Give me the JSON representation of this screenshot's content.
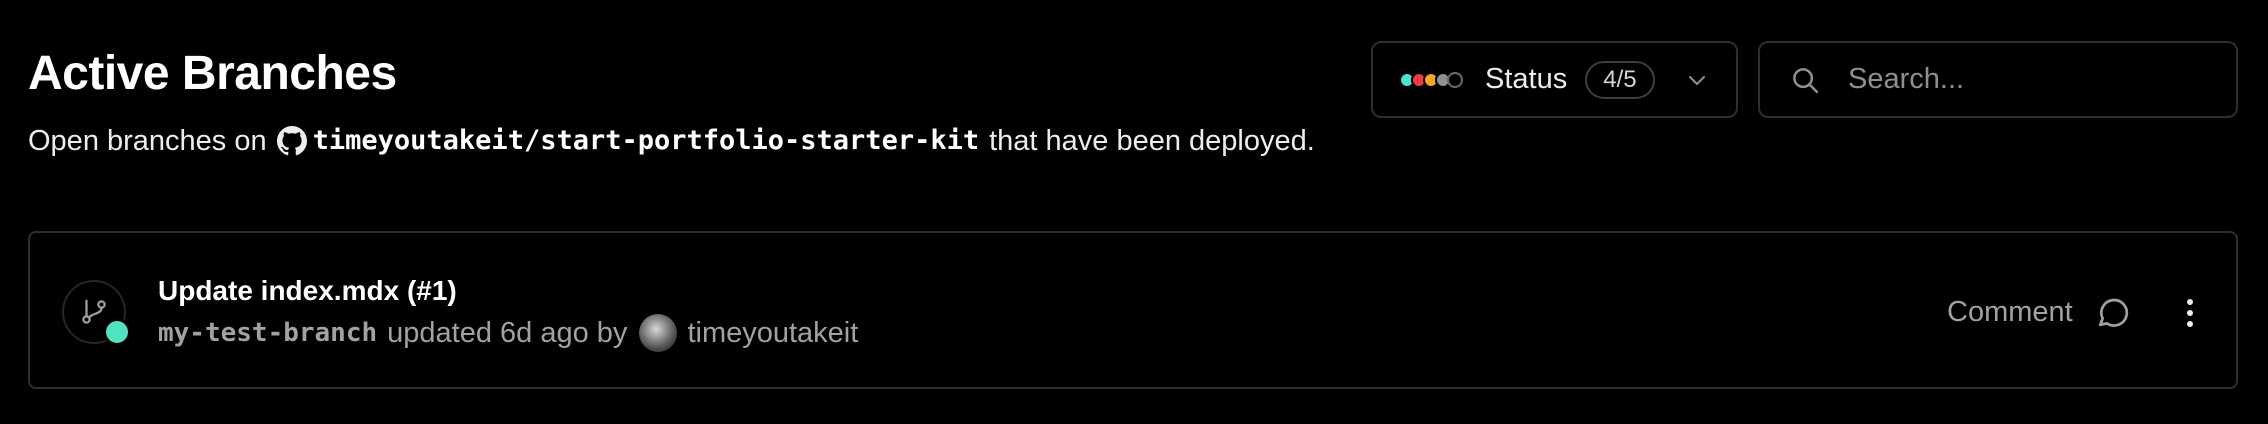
{
  "header": {
    "title": "Active Branches",
    "subtitle_prefix": "Open branches on",
    "repo": "timeyoutakeit/start-portfolio-starter-kit",
    "subtitle_suffix": "that have been deployed."
  },
  "status_filter": {
    "label": "Status",
    "count": "4/5",
    "dot_colors": [
      "#50e3c2",
      "#ee3a44",
      "#f5a623",
      "#8f8f8f",
      "#1a1a1a"
    ]
  },
  "search": {
    "placeholder": "Search..."
  },
  "branches": [
    {
      "title": "Update index.mdx (#1)",
      "branch": "my-test-branch",
      "updated_text": "updated 6d ago by",
      "author": "timeyoutakeit",
      "status_color": "#50e3c2",
      "comment_label": "Comment"
    }
  ],
  "icons": {
    "repo": "github-icon",
    "status_chevron": "chevron-down-icon",
    "search": "search-icon",
    "branch": "git-branch-icon",
    "comment": "comment-icon",
    "more": "more-vertical-icon"
  }
}
